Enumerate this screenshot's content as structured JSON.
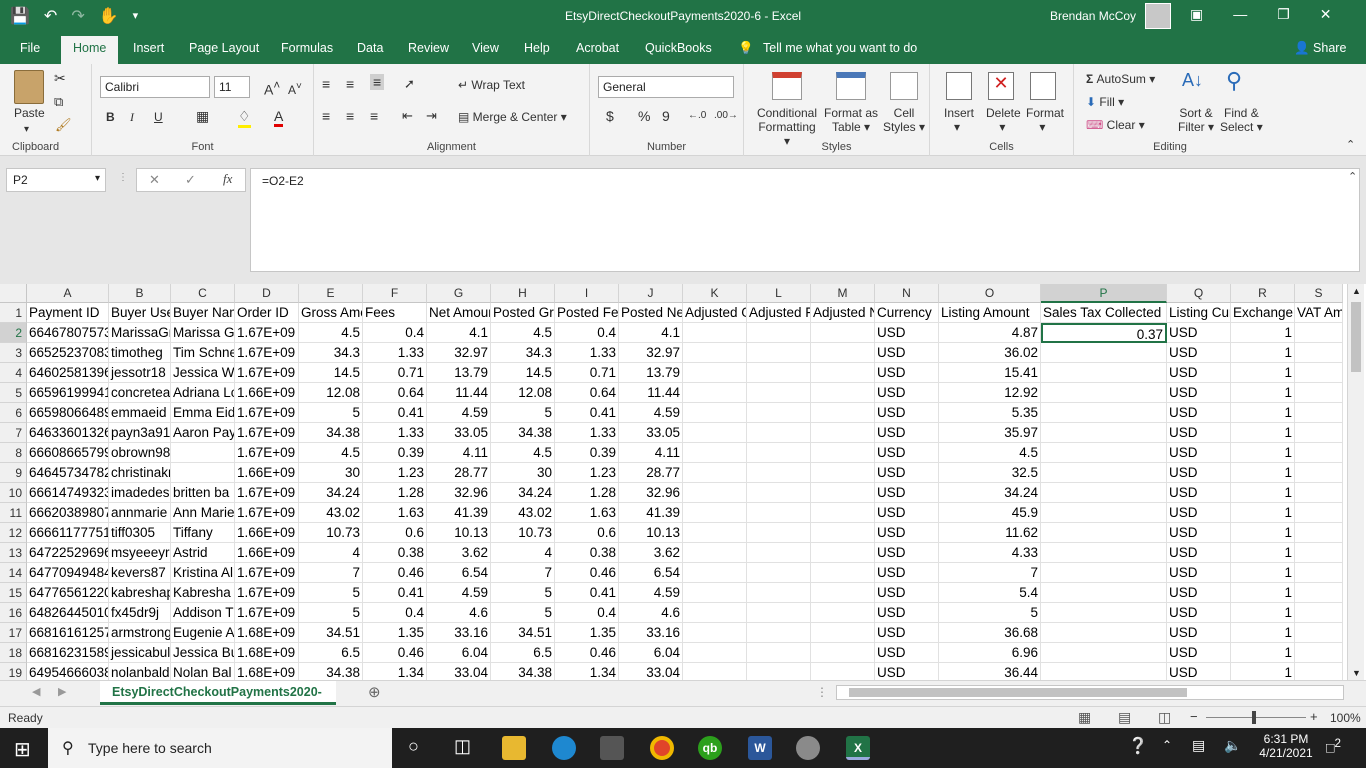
{
  "window": {
    "title": "EtsyDirectCheckoutPayments2020-6  -  Excel",
    "user": "Brendan McCoy"
  },
  "tabs": [
    "File",
    "Home",
    "Insert",
    "Page Layout",
    "Formulas",
    "Data",
    "Review",
    "View",
    "Help",
    "Acrobat",
    "QuickBooks"
  ],
  "tell_me": "Tell me what you want to do",
  "share": "Share",
  "ribbon": {
    "clipboard": {
      "label": "Clipboard",
      "paste": "Paste"
    },
    "font": {
      "label": "Font",
      "name": "Calibri",
      "size": "11",
      "bold": "B",
      "italic": "I",
      "underline": "U"
    },
    "alignment": {
      "label": "Alignment",
      "wrap": "Wrap Text",
      "merge": "Merge & Center"
    },
    "number": {
      "label": "Number",
      "format": "General",
      "currency": "$",
      "percent": "%",
      "comma": "9"
    },
    "styles": {
      "label": "Styles",
      "cond1": "Conditional",
      "cond2": "Formatting",
      "fmt1": "Format as",
      "fmt2": "Table",
      "cell1": "Cell",
      "cell2": "Styles"
    },
    "cells": {
      "label": "Cells",
      "insert": "Insert",
      "delete": "Delete",
      "format": "Format"
    },
    "editing": {
      "label": "Editing",
      "autosum": "AutoSum",
      "fill": "Fill",
      "clear": "Clear",
      "sort1": "Sort &",
      "sort2": "Filter",
      "find1": "Find &",
      "find2": "Select"
    }
  },
  "formula_bar": {
    "name_box": "P2",
    "formula": "=O2-E2"
  },
  "columns": [
    "A",
    "B",
    "C",
    "D",
    "E",
    "F",
    "G",
    "H",
    "I",
    "J",
    "K",
    "L",
    "M",
    "N",
    "O",
    "P",
    "Q",
    "R",
    "S"
  ],
  "selected_column": "P",
  "header_row": [
    "Payment ID",
    "Buyer User",
    "Buyer Name",
    "Order ID",
    "Gross Amount",
    "Fees",
    "Net Amount",
    "Posted Gross",
    "Posted Fees",
    "Posted Net",
    "Adjusted Gross",
    "Adjusted Fees",
    "Adjusted Net",
    "Currency",
    "Listing Amount",
    "Sales Tax Collected",
    "Listing Currency",
    "Exchange",
    "VAT Amount"
  ],
  "rows": [
    [
      "66467807573",
      "MarissaGr",
      "Marissa Gr",
      "1.67E+09",
      "4.5",
      "0.4",
      "4.1",
      "4.5",
      "0.4",
      "4.1",
      "",
      "",
      "",
      "USD",
      "4.87",
      "0.37",
      "USD",
      "1",
      ""
    ],
    [
      "66525237083",
      "timotheg",
      "Tim Schne",
      "1.67E+09",
      "34.3",
      "1.33",
      "32.97",
      "34.3",
      "1.33",
      "32.97",
      "",
      "",
      "",
      "USD",
      "36.02",
      "",
      "USD",
      "1",
      ""
    ],
    [
      "64602581396",
      "jessotr18",
      "Jessica Wh",
      "1.67E+09",
      "14.5",
      "0.71",
      "13.79",
      "14.5",
      "0.71",
      "13.79",
      "",
      "",
      "",
      "USD",
      "15.41",
      "",
      "USD",
      "1",
      ""
    ],
    [
      "66596199941",
      "concretea",
      "Adriana Lo",
      "1.66E+09",
      "12.08",
      "0.64",
      "11.44",
      "12.08",
      "0.64",
      "11.44",
      "",
      "",
      "",
      "USD",
      "12.92",
      "",
      "USD",
      "1",
      ""
    ],
    [
      "66598066489",
      "emmaeid",
      "Emma Eid",
      "1.67E+09",
      "5",
      "0.41",
      "4.59",
      "5",
      "0.41",
      "4.59",
      "",
      "",
      "",
      "USD",
      "5.35",
      "",
      "USD",
      "1",
      ""
    ],
    [
      "64633601326",
      "payn3a91",
      "Aaron Pay",
      "1.67E+09",
      "34.38",
      "1.33",
      "33.05",
      "34.38",
      "1.33",
      "33.05",
      "",
      "",
      "",
      "USD",
      "35.97",
      "",
      "USD",
      "1",
      ""
    ],
    [
      "66608665799",
      "obrown98",
      "",
      "1.67E+09",
      "4.5",
      "0.39",
      "4.11",
      "4.5",
      "0.39",
      "4.11",
      "",
      "",
      "",
      "USD",
      "4.5",
      "",
      "USD",
      "1",
      ""
    ],
    [
      "64645734782",
      "christinaknust",
      "",
      "1.66E+09",
      "30",
      "1.23",
      "28.77",
      "30",
      "1.23",
      "28.77",
      "",
      "",
      "",
      "USD",
      "32.5",
      "",
      "USD",
      "1",
      ""
    ],
    [
      "66614749323",
      "imadedes",
      "britten ba",
      "1.67E+09",
      "34.24",
      "1.28",
      "32.96",
      "34.24",
      "1.28",
      "32.96",
      "",
      "",
      "",
      "USD",
      "34.24",
      "",
      "USD",
      "1",
      ""
    ],
    [
      "66620389807",
      "annmarie",
      "Ann Marie",
      "1.67E+09",
      "43.02",
      "1.63",
      "41.39",
      "43.02",
      "1.63",
      "41.39",
      "",
      "",
      "",
      "USD",
      "45.9",
      "",
      "USD",
      "1",
      ""
    ],
    [
      "66661177751",
      "tiff0305",
      "Tiffany",
      "1.66E+09",
      "10.73",
      "0.6",
      "10.13",
      "10.73",
      "0.6",
      "10.13",
      "",
      "",
      "",
      "USD",
      "11.62",
      "",
      "USD",
      "1",
      ""
    ],
    [
      "64722529696",
      "msyeeeyr",
      "Astrid",
      "1.66E+09",
      "4",
      "0.38",
      "3.62",
      "4",
      "0.38",
      "3.62",
      "",
      "",
      "",
      "USD",
      "4.33",
      "",
      "USD",
      "1",
      ""
    ],
    [
      "64770949484",
      "kevers87",
      "Kristina Al",
      "1.67E+09",
      "7",
      "0.46",
      "6.54",
      "7",
      "0.46",
      "6.54",
      "",
      "",
      "",
      "USD",
      "7",
      "",
      "USD",
      "1",
      ""
    ],
    [
      "64776561220",
      "kabreshap",
      "Kabresha",
      "1.67E+09",
      "5",
      "0.41",
      "4.59",
      "5",
      "0.41",
      "4.59",
      "",
      "",
      "",
      "USD",
      "5.4",
      "",
      "USD",
      "1",
      ""
    ],
    [
      "64826445010",
      "fx45dr9j",
      "Addison T",
      "1.67E+09",
      "5",
      "0.4",
      "4.6",
      "5",
      "0.4",
      "4.6",
      "",
      "",
      "",
      "USD",
      "5",
      "",
      "USD",
      "1",
      ""
    ],
    [
      "66816161257",
      "armstrong",
      "Eugenie A",
      "1.68E+09",
      "34.51",
      "1.35",
      "33.16",
      "34.51",
      "1.35",
      "33.16",
      "",
      "",
      "",
      "USD",
      "36.68",
      "",
      "USD",
      "1",
      ""
    ],
    [
      "66816231589",
      "jessicabul",
      "Jessica Bu",
      "1.68E+09",
      "6.5",
      "0.46",
      "6.04",
      "6.5",
      "0.46",
      "6.04",
      "",
      "",
      "",
      "USD",
      "6.96",
      "",
      "USD",
      "1",
      ""
    ],
    [
      "64954666038",
      "nolanbald",
      "Nolan Bal",
      "1.68E+09",
      "34.38",
      "1.34",
      "33.04",
      "34.38",
      "1.34",
      "33.04",
      "",
      "",
      "",
      "USD",
      "36.44",
      "",
      "USD",
      "1",
      ""
    ]
  ],
  "sheet_tab": "EtsyDirectCheckoutPayments2020-",
  "status": {
    "ready": "Ready",
    "zoom": "100%"
  },
  "taskbar": {
    "search_placeholder": "Type here to search",
    "time": "6:31 PM",
    "date": "4/21/2021",
    "notifications": "2"
  }
}
